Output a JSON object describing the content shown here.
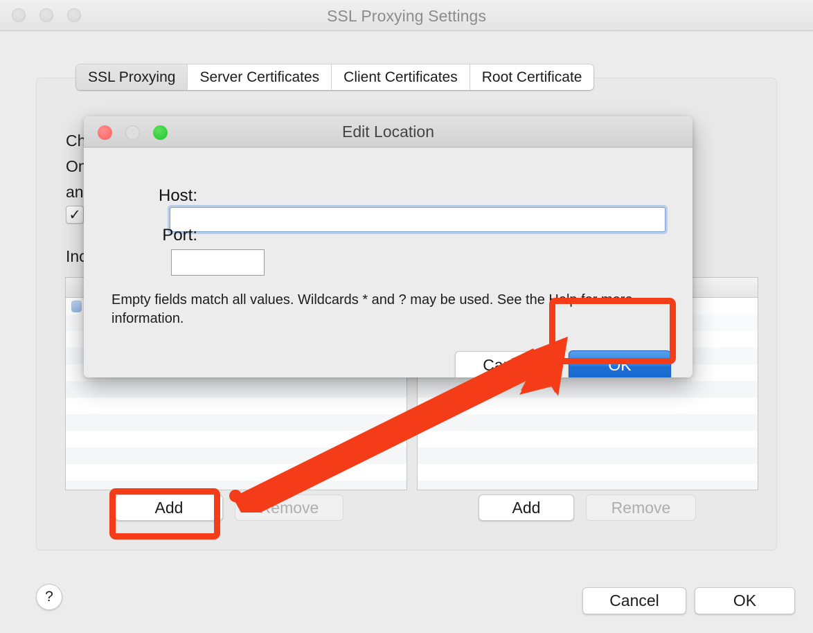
{
  "window": {
    "title": "SSL Proxying Settings",
    "traffic_lights": [
      "close-inactive",
      "minimize-inactive",
      "zoom-inactive"
    ]
  },
  "tabs": [
    {
      "label": "SSL Proxying",
      "selected": true
    },
    {
      "label": "Server Certificates",
      "selected": false
    },
    {
      "label": "Client Certificates",
      "selected": false
    },
    {
      "label": "Root Certificate",
      "selected": false
    }
  ],
  "panel": {
    "description": "Ch                                                                                                ses.\nOn                                                                                               issue\nan                                                                                                  ion.",
    "enable_checkbox": {
      "checked": true,
      "mark": "✓",
      "label": ""
    },
    "include_label": "Inc"
  },
  "lists": {
    "left": {
      "add_label": "Add",
      "remove_label": "Remove",
      "remove_enabled": false,
      "selected_row_checked": true
    },
    "right": {
      "add_label": "Add",
      "remove_label": "Remove",
      "remove_enabled": false
    }
  },
  "bottom_bar": {
    "help_label": "?",
    "cancel_label": "Cancel",
    "ok_label": "OK"
  },
  "dialog": {
    "title": "Edit Location",
    "traffic_lights": {
      "close": "red",
      "minimize": "gray-disabled",
      "zoom": "green"
    },
    "host": {
      "label": "Host:",
      "value": "",
      "placeholder": "",
      "focused": true
    },
    "port": {
      "label": "Port:",
      "value": "",
      "placeholder": ""
    },
    "note": "Empty fields match all values. Wildcards * and ? may be used. See the Help for more information.",
    "cancel_label": "Cancel",
    "ok_label": "OK"
  },
  "annotations": {
    "color": "#f43d18",
    "highlight_ok_button": true,
    "highlight_add_button": true,
    "arrow_from": "add-button",
    "arrow_to": "ok-button"
  },
  "colors": {
    "window_bg": "#ececec",
    "accent_blue": "#2f7ddd",
    "annotation_red": "#f43d18",
    "focus_ring": "#b9cde9",
    "traffic_red": "#f85f5f",
    "traffic_green": "#22c52e"
  }
}
